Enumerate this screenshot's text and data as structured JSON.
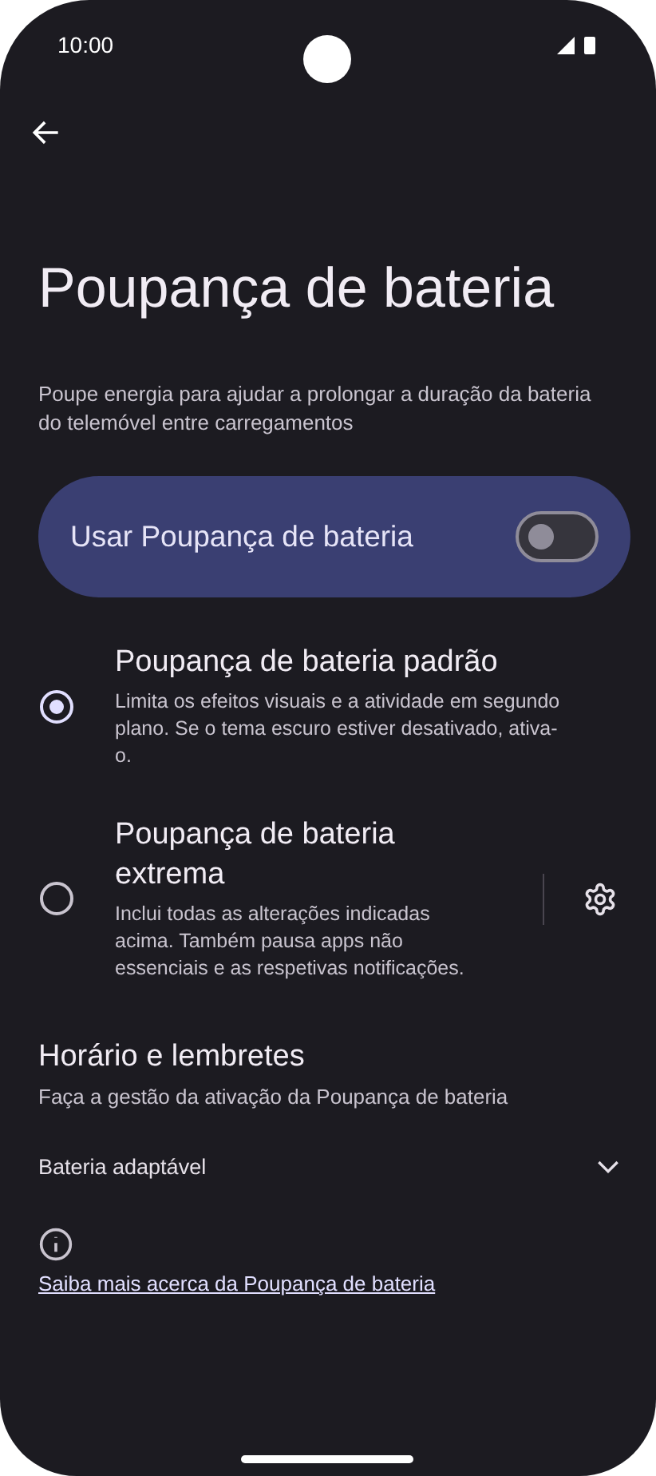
{
  "status_bar": {
    "time": "10:00"
  },
  "title": "Poupança de bateria",
  "description": "Poupe energia para ajudar a prolongar a duração da bateria do telemóvel entre carregamentos",
  "main_toggle": {
    "label": "Usar Poupança de bateria",
    "on": false
  },
  "options": [
    {
      "title": "Poupança de bateria padrão",
      "description": "Limita os efeitos visuais e a atividade em segundo plano. Se o tema escuro estiver desativado, ativa-o.",
      "selected": true,
      "has_settings": false
    },
    {
      "title": "Poupança de bateria extrema",
      "description": "Inclui todas as alterações indicadas acima. Também pausa apps não essenciais e as respetivas notificações.",
      "selected": false,
      "has_settings": true
    }
  ],
  "schedule": {
    "title": "Horário e lembretes",
    "subtitle": "Faça a gestão da ativação da Poupança de bateria"
  },
  "adaptive": {
    "label": "Bateria adaptável",
    "expanded": false
  },
  "learn_more": "Saiba mais acerca da Poupança de bateria"
}
